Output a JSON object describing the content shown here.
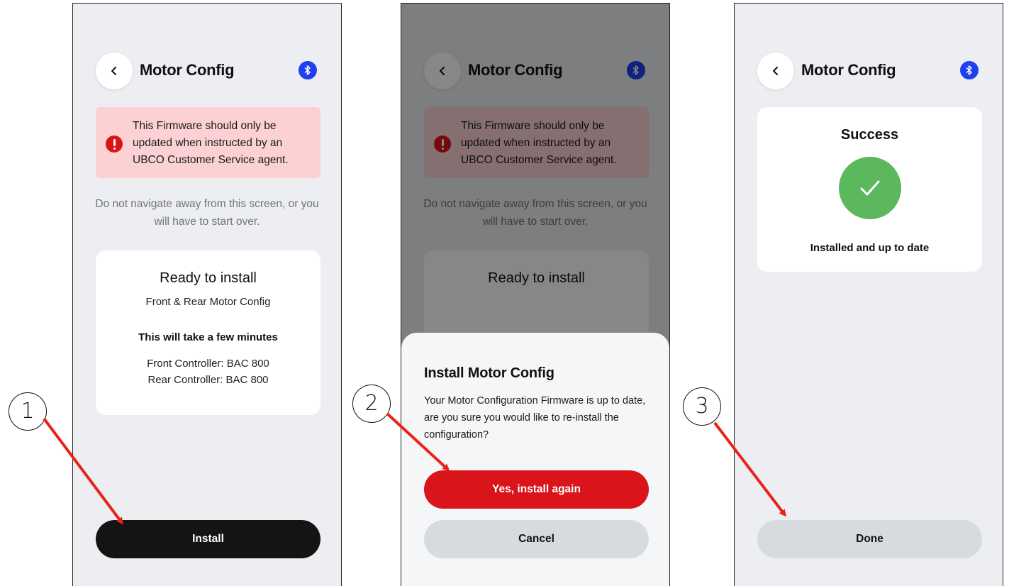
{
  "header": {
    "title": "Motor Config"
  },
  "warning": {
    "text": "This Firmware should only be updated when instructed by an UBCO Customer Service agent."
  },
  "nav_note": "Do not navigate away from this screen, or you will have to start over.",
  "install_card": {
    "title": "Ready to install",
    "subtitle": "Front & Rear Motor Config",
    "duration": "This will take a few minutes",
    "front_controller": "Front Controller: BAC 800",
    "rear_controller": "Rear Controller: BAC 800"
  },
  "install_button": "Install",
  "dialog": {
    "title": "Install Motor Config",
    "message": "Your Motor Configuration Firmware is up to date, are you sure you would like to re-install the configuration?",
    "confirm": "Yes, install again",
    "cancel": "Cancel"
  },
  "success": {
    "title": "Success",
    "message": "Installed and up to date",
    "done": "Done"
  },
  "steps": [
    "1",
    "2",
    "3"
  ],
  "colors": {
    "accent_red": "#d9141b",
    "warning_bg": "#fbd1d3",
    "success_green": "#5cb85c",
    "bluetooth_blue": "#1f3ff0"
  },
  "icons": [
    "back-chevron-icon",
    "bluetooth-icon",
    "alert-icon",
    "checkmark-icon"
  ]
}
